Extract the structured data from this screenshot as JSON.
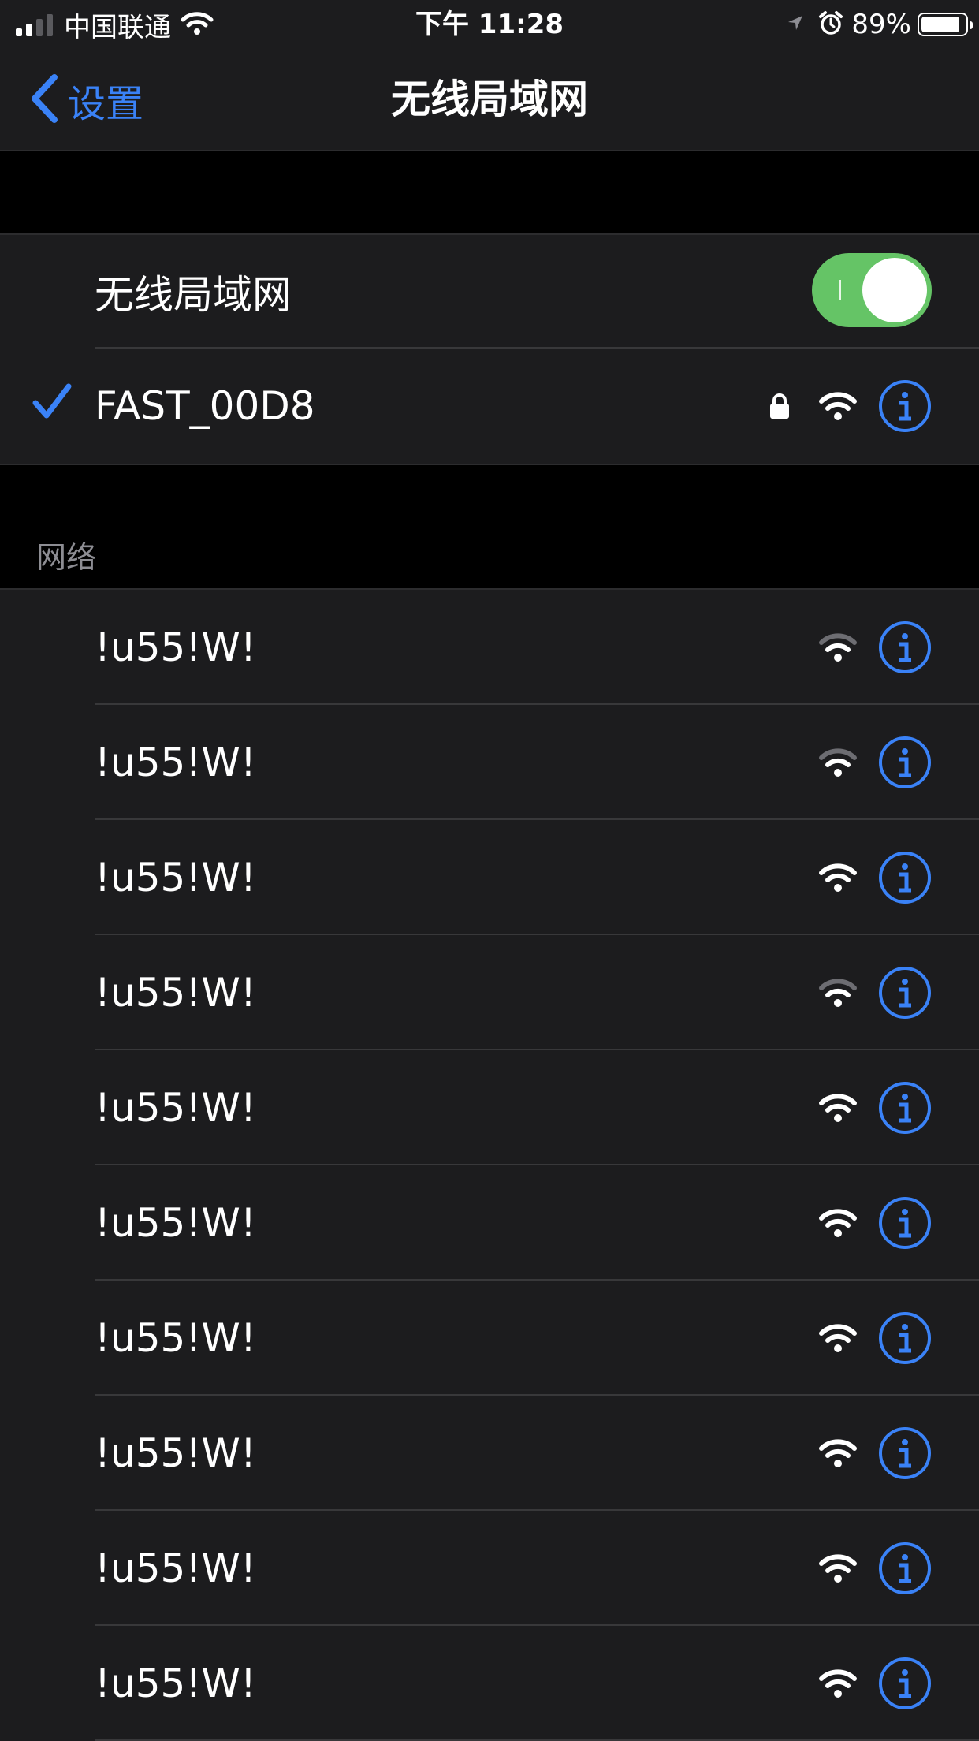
{
  "status_bar": {
    "carrier": "中国联通",
    "time": "下午 11:28",
    "battery_percent": "89%",
    "battery_level": 0.89,
    "signal_bars": 2
  },
  "nav": {
    "back_label": "设置",
    "title": "无线局域网"
  },
  "wifi_toggle": {
    "label": "无线局域网",
    "on": true
  },
  "connected_network": {
    "name": "FAST_00D8",
    "secured": true,
    "signal": "full"
  },
  "networks_header": "网络",
  "networks": [
    {
      "name": "!u55!W!",
      "signal": "weak"
    },
    {
      "name": "!u55!W!",
      "signal": "weak"
    },
    {
      "name": "!u55!W!",
      "signal": "full"
    },
    {
      "name": "!u55!W!",
      "signal": "weak"
    },
    {
      "name": "!u55!W!",
      "signal": "full"
    },
    {
      "name": "!u55!W!",
      "signal": "full"
    },
    {
      "name": "!u55!W!",
      "signal": "full"
    },
    {
      "name": "!u55!W!",
      "signal": "full"
    },
    {
      "name": "!u55!W!",
      "signal": "full"
    },
    {
      "name": "!u55!W!",
      "signal": "full"
    }
  ],
  "colors": {
    "accent": "#3a82f7",
    "toggle_on": "#65c466",
    "cell_bg": "#1c1c1e",
    "page_bg": "#000000",
    "wifi_dim": "#6d6d72"
  },
  "icons": {
    "back": "chevron-left-icon",
    "check": "checkmark-icon",
    "lock": "lock-icon",
    "wifi": "wifi-icon",
    "info": "info-icon"
  }
}
